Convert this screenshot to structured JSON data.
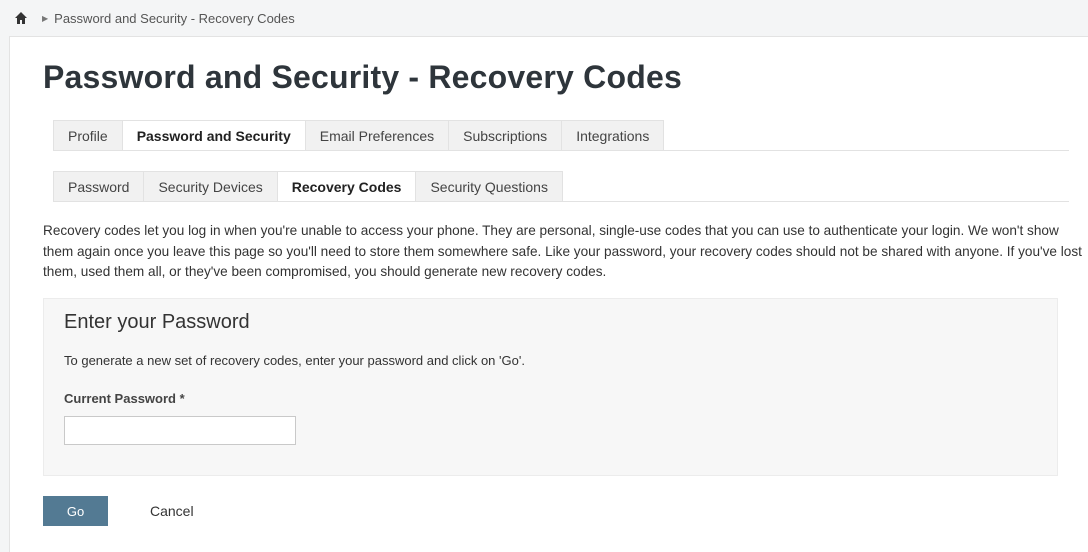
{
  "breadcrumb": {
    "home_icon": "home-icon",
    "separator_icon": "caret-right-icon",
    "current": "Password and Security - Recovery Codes"
  },
  "page_title": "Password and Security - Recovery Codes",
  "primary_tabs": [
    {
      "label": "Profile",
      "active": false
    },
    {
      "label": "Password and Security",
      "active": true
    },
    {
      "label": "Email Preferences",
      "active": false
    },
    {
      "label": "Subscriptions",
      "active": false
    },
    {
      "label": "Integrations",
      "active": false
    }
  ],
  "secondary_tabs": [
    {
      "label": "Password",
      "active": false
    },
    {
      "label": "Security Devices",
      "active": false
    },
    {
      "label": "Recovery Codes",
      "active": true
    },
    {
      "label": "Security Questions",
      "active": false
    }
  ],
  "intro_text": "Recovery codes let you log in when you're unable to access your phone. They are personal, single-use codes that you can use to authenticate your login. We won't show them again once you leave this page so you'll need to store them somewhere safe. Like your password, your recovery codes should not be shared with anyone. If you've lost them, used them all, or they've been compromised, you should generate new recovery codes.",
  "panel": {
    "title": "Enter your Password",
    "description": "To generate a new set of recovery codes, enter your password and click on 'Go'.",
    "field_label": "Current Password *",
    "field_value": "",
    "field_placeholder": ""
  },
  "actions": {
    "go_label": "Go",
    "cancel_label": "Cancel"
  },
  "colors": {
    "primary_button": "#537a93",
    "title": "#2e353b"
  }
}
